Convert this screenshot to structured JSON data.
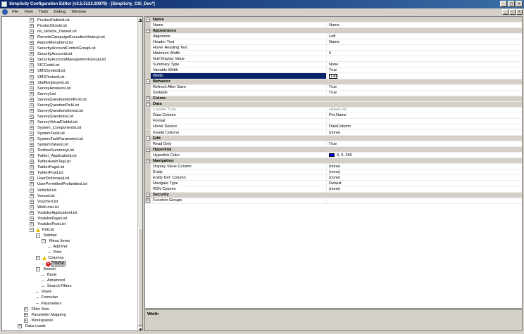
{
  "window": {
    "title": "Simplicity Configuration Editor (v3.5.5123.20879) - [Simplicity_CIS_Dev*]",
    "controls": [
      "_",
      "□",
      "×"
    ]
  },
  "menu": [
    "File",
    "View",
    "Tools",
    "Debug",
    "Window"
  ],
  "mdi_controls": [
    "_",
    "□",
    "×"
  ],
  "tree": [
    {
      "label": "ProductOutletsList",
      "indent": 2,
      "kind": "plus"
    },
    {
      "label": "ProductStockList",
      "indent": 2,
      "kind": "plus"
    },
    {
      "label": "rel_Vehicle_OwnerList",
      "indent": 2,
      "kind": "plus"
    },
    {
      "label": "RemoteCampaignExecutionHistoryList",
      "indent": 2,
      "kind": "plus"
    },
    {
      "label": "ReportMenuItemList",
      "indent": 2,
      "kind": "plus"
    },
    {
      "label": "SecurityAccountControlGroupList",
      "indent": 2,
      "kind": "plus"
    },
    {
      "label": "SecurityAccountList",
      "indent": 2,
      "kind": "plus"
    },
    {
      "label": "SecurityAccountManagementGroupList",
      "indent": 2,
      "kind": "plus"
    },
    {
      "label": "SICCodeList",
      "indent": 2,
      "kind": "plus"
    },
    {
      "label": "SMSSymbolList",
      "indent": 2,
      "kind": "plus"
    },
    {
      "label": "SMSTextsetList",
      "indent": 2,
      "kind": "plus"
    },
    {
      "label": "StaffEmployeeList",
      "indent": 2,
      "kind": "plus"
    },
    {
      "label": "SurveyAnswersList",
      "indent": 2,
      "kind": "plus"
    },
    {
      "label": "SurveyList",
      "indent": 2,
      "kind": "plus"
    },
    {
      "label": "SurveyQuestionItemPickList",
      "indent": 2,
      "kind": "plus"
    },
    {
      "label": "SurveyQuestionPickList",
      "indent": 2,
      "kind": "plus"
    },
    {
      "label": "SurveyQuestionsItemsList",
      "indent": 2,
      "kind": "plus"
    },
    {
      "label": "SurveyQuestionsList",
      "indent": 2,
      "kind": "plus"
    },
    {
      "label": "SurveyVirtualFieldsList",
      "indent": 2,
      "kind": "plus"
    },
    {
      "label": "System_ComponentsList",
      "indent": 2,
      "kind": "plus"
    },
    {
      "label": "SystemTaskList",
      "indent": 2,
      "kind": "plus"
    },
    {
      "label": "SystemTaskParameterList",
      "indent": 2,
      "kind": "plus"
    },
    {
      "label": "SystemValuesList",
      "indent": 2,
      "kind": "plus"
    },
    {
      "label": "ToolboxSummaryList",
      "indent": 2,
      "kind": "plus"
    },
    {
      "label": "Twitter_ApplicationList",
      "indent": 2,
      "kind": "plus"
    },
    {
      "label": "TwitterHashTagList",
      "indent": 2,
      "kind": "plus"
    },
    {
      "label": "TwitterPageList",
      "indent": 2,
      "kind": "plus"
    },
    {
      "label": "TwitterPostList",
      "indent": 2,
      "kind": "plus"
    },
    {
      "label": "UserDictionaryList",
      "indent": 2,
      "kind": "plus"
    },
    {
      "label": "UserPermittedProfanitiesList",
      "indent": 2,
      "kind": "plus"
    },
    {
      "label": "VehicleList",
      "indent": 2,
      "kind": "plus"
    },
    {
      "label": "VenueList",
      "indent": 2,
      "kind": "plus"
    },
    {
      "label": "VoucherList",
      "indent": 2,
      "kind": "plus"
    },
    {
      "label": "WebLinkList",
      "indent": 2,
      "kind": "plus"
    },
    {
      "label": "YoutubeApplicationList",
      "indent": 2,
      "kind": "plus"
    },
    {
      "label": "YoutubePageList",
      "indent": 2,
      "kind": "plus"
    },
    {
      "label": "YoutubePostList",
      "indent": 2,
      "kind": "plus"
    },
    {
      "label": "PetList",
      "indent": 2,
      "kind": "minus-warn"
    },
    {
      "label": "Sidebar",
      "indent": 3,
      "kind": "minus"
    },
    {
      "label": "Menu Items",
      "indent": 4,
      "kind": "minus"
    },
    {
      "label": "Add Pet",
      "indent": 5,
      "kind": "leaf"
    },
    {
      "label": "Print",
      "indent": 5,
      "kind": "leaf"
    },
    {
      "label": "Columns",
      "indent": 3,
      "kind": "minus-warn"
    },
    {
      "label": "Name",
      "indent": 4,
      "kind": "leaf-error"
    },
    {
      "label": "Search",
      "indent": 3,
      "kind": "minus"
    },
    {
      "label": "Basic",
      "indent": 4,
      "kind": "leaf"
    },
    {
      "label": "Advanced",
      "indent": 4,
      "kind": "leaf"
    },
    {
      "label": "Search Filters",
      "indent": 4,
      "kind": "leaf"
    },
    {
      "label": "Views",
      "indent": 3,
      "kind": "leaf"
    },
    {
      "label": "Formulae",
      "indent": 3,
      "kind": "leaf"
    },
    {
      "label": "Parameters",
      "indent": 3,
      "kind": "leaf"
    },
    {
      "label": "Filter Sets",
      "indent": 1,
      "kind": "plus"
    },
    {
      "label": "Parameter Mapping",
      "indent": 1,
      "kind": "plus"
    },
    {
      "label": "Workspaces",
      "indent": 1,
      "kind": "plus"
    },
    {
      "label": "Data Loads",
      "indent": 0,
      "kind": "plus"
    }
  ],
  "properties": [
    {
      "type": "category",
      "label": "Name",
      "toggle": "−"
    },
    {
      "type": "prop",
      "name": "Name",
      "value": "Name"
    },
    {
      "type": "category",
      "label": "Appearance",
      "toggle": "−"
    },
    {
      "type": "prop",
      "name": "Alignment",
      "value": "Left"
    },
    {
      "type": "prop",
      "name": "Header Text",
      "value": "Name"
    },
    {
      "type": "prop",
      "name": "Hover Heading Text",
      "value": ""
    },
    {
      "type": "prop",
      "name": "Minimum Width",
      "value": "0"
    },
    {
      "type": "prop",
      "name": "Null Display Value",
      "value": ""
    },
    {
      "type": "prop",
      "name": "Summary Type",
      "value": "None"
    },
    {
      "type": "prop",
      "name": "Variable Width",
      "value": "True"
    },
    {
      "type": "prop",
      "name": "Width",
      "value": "140",
      "selected": true
    },
    {
      "type": "category",
      "label": "Behavior",
      "toggle": "−"
    },
    {
      "type": "prop",
      "name": "Refresh After Save",
      "value": "True"
    },
    {
      "type": "prop",
      "name": "Sortable",
      "value": "True"
    },
    {
      "type": "category",
      "label": "Colors",
      "toggle": "+"
    },
    {
      "type": "category",
      "label": "Data",
      "toggle": "−"
    },
    {
      "type": "prop",
      "name": "Column Type",
      "value": "HyperLink",
      "disabled": true
    },
    {
      "type": "prop",
      "name": "Data Column",
      "value": "Pet.Name"
    },
    {
      "type": "prop",
      "name": "Format",
      "value": ""
    },
    {
      "type": "prop",
      "name": "Hover Source",
      "value": "DataColumn"
    },
    {
      "type": "prop",
      "name": "Invalid Column",
      "value": "(none)"
    },
    {
      "type": "category",
      "label": "Edit",
      "toggle": "−"
    },
    {
      "type": "prop",
      "name": "Read Only",
      "value": "True"
    },
    {
      "type": "category",
      "label": "Hyperlink",
      "toggle": "−"
    },
    {
      "type": "prop",
      "name": "Hyperlink Color",
      "value": "0, 0, 255",
      "swatch": "#0000ff"
    },
    {
      "type": "category",
      "label": "Navigation",
      "toggle": "−"
    },
    {
      "type": "prop",
      "name": "Display Value Column",
      "value": "(none)"
    },
    {
      "type": "prop",
      "name": "Entity",
      "value": "(none)"
    },
    {
      "type": "prop",
      "name": "Entity Def. Column",
      "value": "(none)"
    },
    {
      "type": "prop",
      "name": "Navigate Type",
      "value": "Default"
    },
    {
      "type": "prop",
      "name": "RSN Column",
      "value": "(none)"
    },
    {
      "type": "category",
      "label": "Security",
      "toggle": "−"
    },
    {
      "type": "prop",
      "name": "Function Groups",
      "value": "",
      "expandable": true
    }
  ],
  "description": {
    "title": "Width"
  },
  "colors": {
    "titlebar_start": "#0a246a",
    "titlebar_end": "#3a6ea5",
    "selection": "#0a246a",
    "hyperlink_swatch": "#0000ff"
  }
}
